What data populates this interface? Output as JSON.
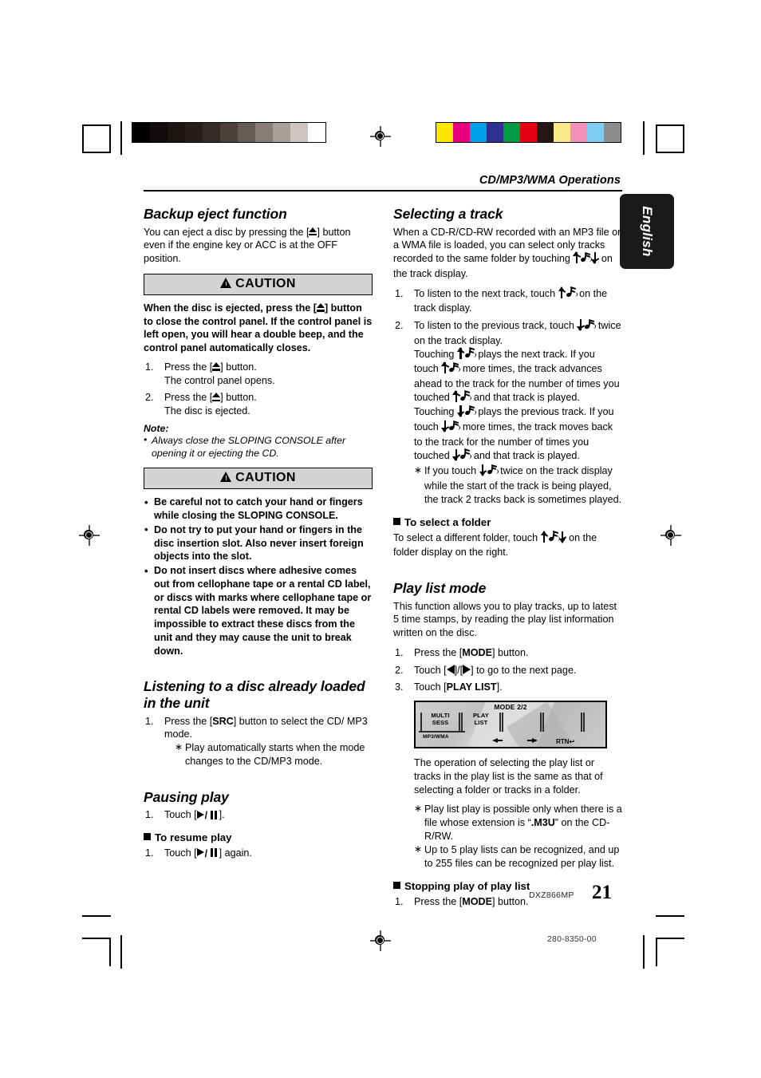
{
  "document": {
    "running_head": "CD/MP3/WMA Operations",
    "language_tab": "English",
    "model": "DXZ866MP",
    "page_number": "21",
    "doc_code": "280-8350-00"
  },
  "left_column": {
    "section1": {
      "heading": "Backup eject function",
      "body": "You can eject a disc by pressing the [⏏] button even if the engine key or ACC is at the OFF position."
    },
    "caution1": {
      "label": "CAUTION",
      "warning": "When the disc is ejected, press the [⏏] button to close the control panel. If the control panel is left open, you will hear a double beep, and the control panel automatically closes.",
      "steps": [
        {
          "num": "1.",
          "text": "Press the [⏏] button.",
          "sub": "The control panel opens."
        },
        {
          "num": "2.",
          "text": "Press the [⏏] button.",
          "sub": "The disc is ejected."
        }
      ],
      "note_label": "Note:",
      "notes": [
        "Always close the SLOPING CONSOLE after opening it or ejecting the CD."
      ]
    },
    "caution2": {
      "label": "CAUTION",
      "bullets": [
        "Be careful not to catch your hand or fingers while closing the SLOPING CONSOLE.",
        "Do not try to put your hand or fingers in the disc insertion slot. Also never insert foreign objects into the slot.",
        "Do not insert discs where adhesive comes out from cellophane tape or a rental CD label, or discs with marks where cellophane tape or rental CD labels were removed. It may be impossible to extract these discs from the unit and they may cause the unit to break down."
      ]
    },
    "section2": {
      "heading": "Listening to a disc already loaded in the unit",
      "step_num": "1.",
      "step_pre": "Press the [",
      "step_bold": "SRC",
      "step_post": "] button to select the CD/ MP3 mode.",
      "star": "Play automatically starts when the mode changes to the CD/MP3 mode."
    },
    "section3": {
      "heading": "Pausing play",
      "step_num": "1.",
      "step_pre": "Touch [",
      "step_post": "].",
      "sub_heading": "To resume play",
      "step2_num": "1.",
      "step2_pre": "Touch [",
      "step2_post": "] again."
    }
  },
  "right_column": {
    "section1": {
      "heading": "Selecting a track",
      "body_pre": "When a CD-R/CD-RW recorded with an MP3 file or a WMA file is loaded, you can select only tracks recorded to the same folder by touching",
      "body_post": "on the track display.",
      "steps": [
        {
          "num": "1.",
          "pre": "To listen to the next track, touch",
          "post": "on the track display."
        },
        {
          "num": "2.",
          "pre": "To listen to the previous track, touch",
          "post": "twice on the track display."
        }
      ],
      "para_a_1": "Touching",
      "para_a_2": "plays the next track. If you touch",
      "para_a_3": "more times, the track advances ahead to the track for the number of times you touched",
      "para_a_4": "and that track is played.",
      "para_b_1": "Touching",
      "para_b_2": "plays the previous track. If you touch",
      "para_b_3": "more times, the track moves back to the track for the number of times you touched",
      "para_b_4": "and that track is played.",
      "star_1": "If you touch",
      "star_2": "twice on the track display while the start of the track is being played, the track 2 tracks back is sometimes played.",
      "folder_heading": "To select a folder",
      "folder_pre": "To select a different folder, touch",
      "folder_post": "on the folder display on the right."
    },
    "section2": {
      "heading": "Play list mode",
      "body": "This function allows you to play tracks, up to latest 5 time stamps, by reading the play list information written on the disc.",
      "steps": [
        {
          "num": "1.",
          "pre": "Press the [",
          "bold": "MODE",
          "post": "] button."
        },
        {
          "num": "2.",
          "pre": "Touch [",
          "mid": "]/[",
          "post": "] to go to the next page."
        },
        {
          "num": "3.",
          "pre": "Touch [",
          "bold": "PLAY LIST",
          "post": "]."
        }
      ],
      "device_display": {
        "mode_label": "MODE 2/2",
        "key1_line1": "MULTI",
        "key1_line2": "SESS",
        "key2_line1": "PLAY",
        "key2_line2": "LIST",
        "format_label": "MP3/WMA",
        "return_label": "RTN"
      },
      "after_body": "The operation of selecting the play list or tracks in the play list is the same as that of selecting a folder or tracks in a folder.",
      "star_notes": [
        {
          "pre": "Play list play is possible only when there is a file whose extension is “",
          "bold": ".M3U",
          "post": "” on the CD-R/RW."
        },
        {
          "pre": "Up to 5 play lists can be recognized, and up to 255 files can be recognized per play list.",
          "bold": "",
          "post": ""
        }
      ],
      "stop_heading": "Stopping play of play list",
      "stop_step": {
        "num": "1.",
        "pre": "Press the [",
        "bold": "MODE",
        "post": "] button."
      }
    }
  },
  "printer_marks": {
    "grayscale_wedge": [
      "#000000",
      "#100c0b",
      "#1b1613",
      "#251e1a",
      "#332b27",
      "#4a413c",
      "#665c56",
      "#877d78",
      "#a89f9a",
      "#cdc5c1",
      "#ffffff"
    ],
    "color_bar": [
      "#ffe800",
      "#e6007e",
      "#00a0e9",
      "#2e3192",
      "#009944",
      "#e60012",
      "#231815",
      "#fbe98a",
      "#f390b9",
      "#7ecef4",
      "#8d8d8d"
    ],
    "registration_icon": "registration-target-icon"
  }
}
